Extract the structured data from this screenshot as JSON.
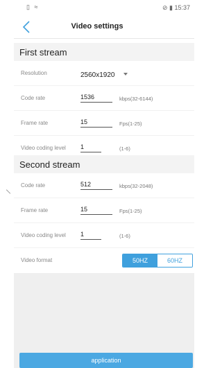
{
  "status_bar": {
    "left_icons": "▯ ≈",
    "right_text": "⊘ ▮ 15:37"
  },
  "nav": {
    "title": "Video settings"
  },
  "first_stream": {
    "title": "First stream",
    "resolution_label": "Resolution",
    "resolution_value": "2560x1920",
    "code_rate_label": "Code rate",
    "code_rate_value": "1536",
    "code_rate_hint": "kbps(32-6144)",
    "frame_rate_label": "Frame rate",
    "frame_rate_value": "15",
    "frame_rate_hint": "Fps(1-25)",
    "coding_level_label": "Video coding level",
    "coding_level_value": "1",
    "coding_level_hint": "(1-6)"
  },
  "second_stream": {
    "title": "Second stream",
    "code_rate_label": "Code rate",
    "code_rate_value": "512",
    "code_rate_hint": "kbps(32-2048)",
    "frame_rate_label": "Frame rate",
    "frame_rate_value": "15",
    "frame_rate_hint": "Fps(1-25)",
    "coding_level_label": "Video coding level",
    "coding_level_value": "1",
    "coding_level_hint": "(1-6)"
  },
  "video_format": {
    "label": "Video format",
    "options": [
      "50HZ",
      "60HZ"
    ],
    "selected": "50HZ"
  },
  "apply_button": {
    "label": "application"
  },
  "colors": {
    "accent": "#3fa0dd",
    "button": "#4ba8e2",
    "section_bg": "#f3f3f3"
  }
}
